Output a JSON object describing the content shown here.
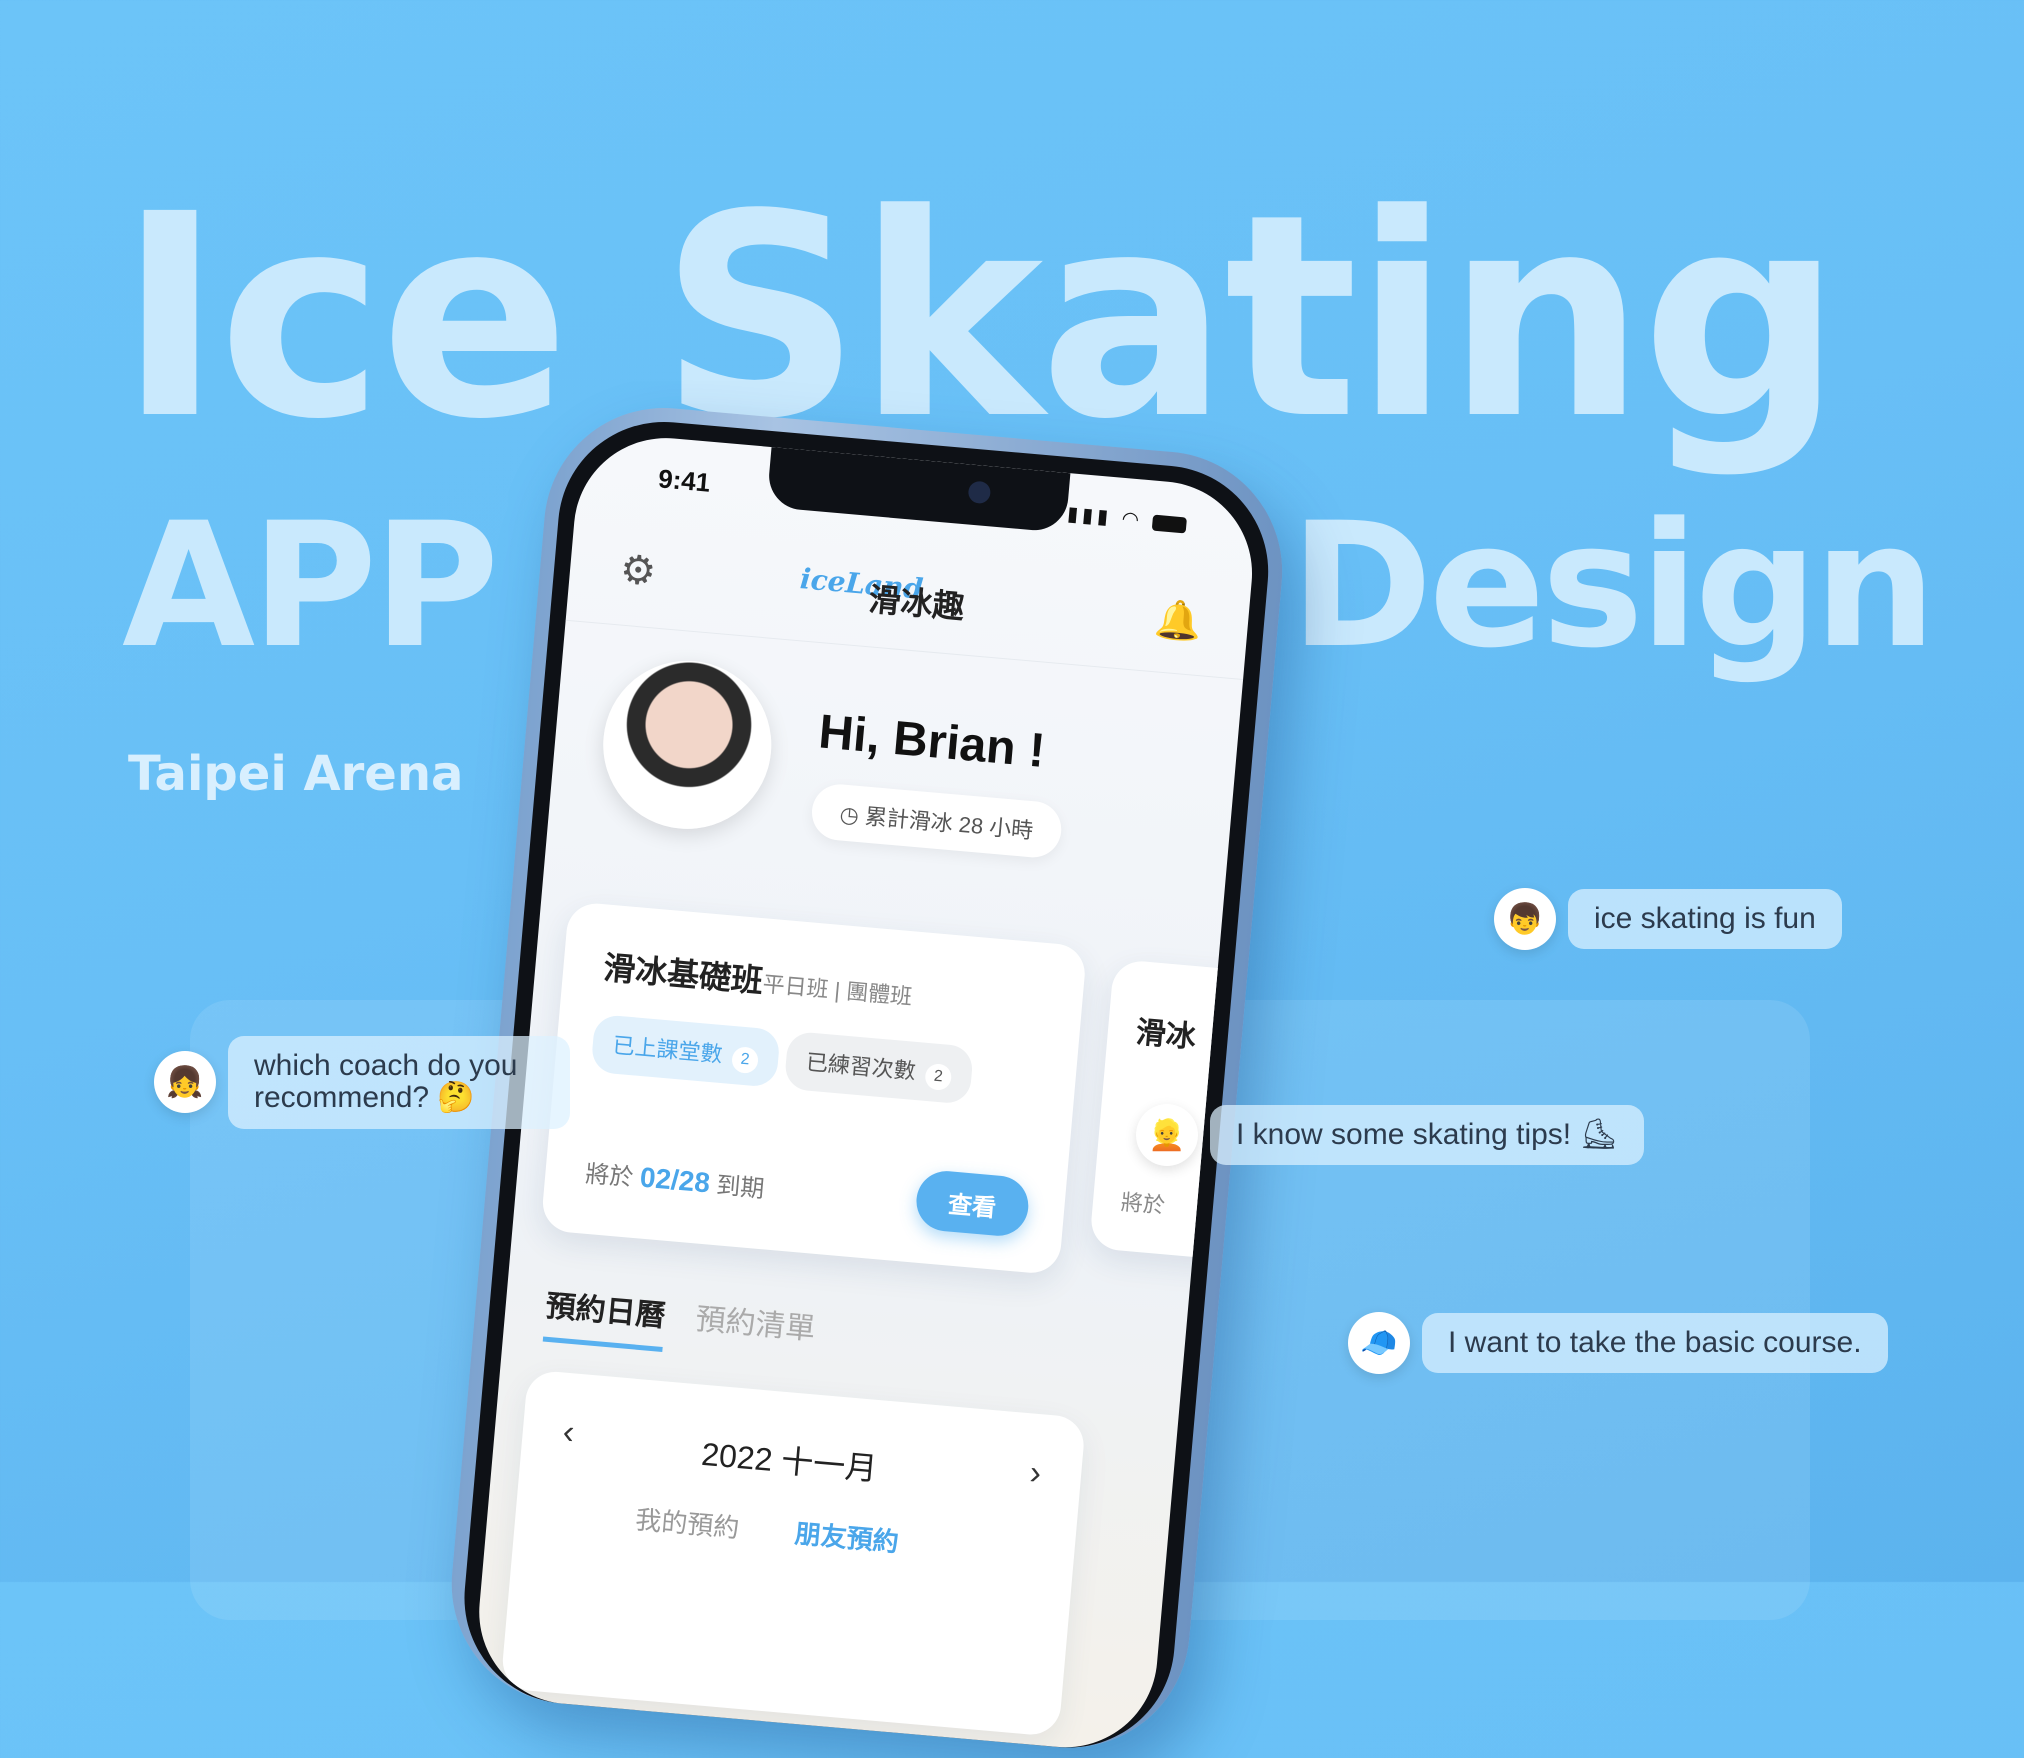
{
  "hero": {
    "line1": "Ice Skating",
    "line2a": "APP",
    "line2b": "Design",
    "venue": "Taipei Arena"
  },
  "phone": {
    "status_time": "9:41",
    "app_logo": "iceLand",
    "app_name": "滑冰趣",
    "greeting": "Hi, Brian !",
    "hours_pill": "累計滑冰 28 小時",
    "course": {
      "title": "滑冰基礎班",
      "type": "平日班 | 團體班",
      "chip_attended_label": "已上課堂數",
      "chip_attended_count": "2",
      "chip_practice_label": "已練習次數",
      "chip_practice_count": "2",
      "expire_prefix": "將於",
      "expire_date": "02/28",
      "expire_suffix": "到期",
      "view_button": "查看"
    },
    "peek_card": {
      "title": "滑冰",
      "sub": "將於"
    },
    "tabs": [
      "預約日曆",
      "預約清單"
    ],
    "calendar": {
      "month": "2022 十一月",
      "prev": "‹",
      "next": "›",
      "tab_mine": "我的預約",
      "tab_friends": "朋友預約"
    }
  },
  "chats": [
    {
      "text": "ice skating is fun",
      "icon": "boy-glasses-avatar"
    },
    {
      "text": "which coach do you recommend? 🤔",
      "icon": "girl-avatar"
    },
    {
      "text": "I know some skating tips! ⛸",
      "icon": "girl-hat-avatar"
    },
    {
      "text": "I want to take the basic course.",
      "icon": "boy-cap-avatar"
    }
  ],
  "colors": {
    "accent": "#59b1f0",
    "background": "#6cc4f8",
    "hero_text": "#c9e9fd"
  }
}
